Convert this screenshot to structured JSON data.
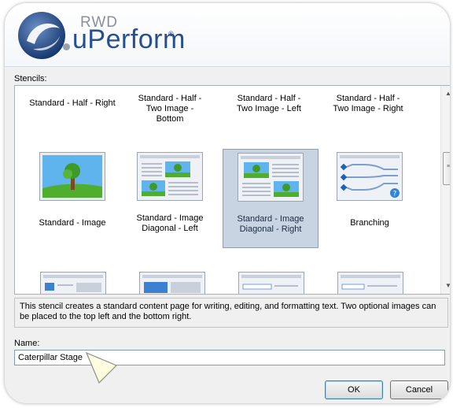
{
  "app": {
    "brand_top": "RWD",
    "brand_name": "uPerform",
    "brand_reg": "®"
  },
  "stencils": {
    "label": "Stencils:",
    "rows": [
      [
        {
          "label": "Standard - Half - Right"
        },
        {
          "label": "Standard - Half - Two Image - Bottom"
        },
        {
          "label": "Standard - Half - Two Image - Left"
        },
        {
          "label": "Standard - Half - Two Image - Right"
        }
      ],
      [
        {
          "label": "Standard - Image"
        },
        {
          "label": "Standard - Image Diagonal - Left"
        },
        {
          "label": "Standard - Image Diagonal - Right",
          "selected": true
        },
        {
          "label": "Branching"
        }
      ]
    ]
  },
  "description": "This stencil creates a standard content page for writing, editing, and formatting text. Two optional images can be placed to the top left and the bottom right.",
  "name_field": {
    "label": "Name:",
    "value": "Caterpillar Stage"
  },
  "buttons": {
    "ok": "OK",
    "cancel": "Cancel"
  },
  "colors": {
    "accent": "#264f8f",
    "selection": "#c8d4e2"
  }
}
